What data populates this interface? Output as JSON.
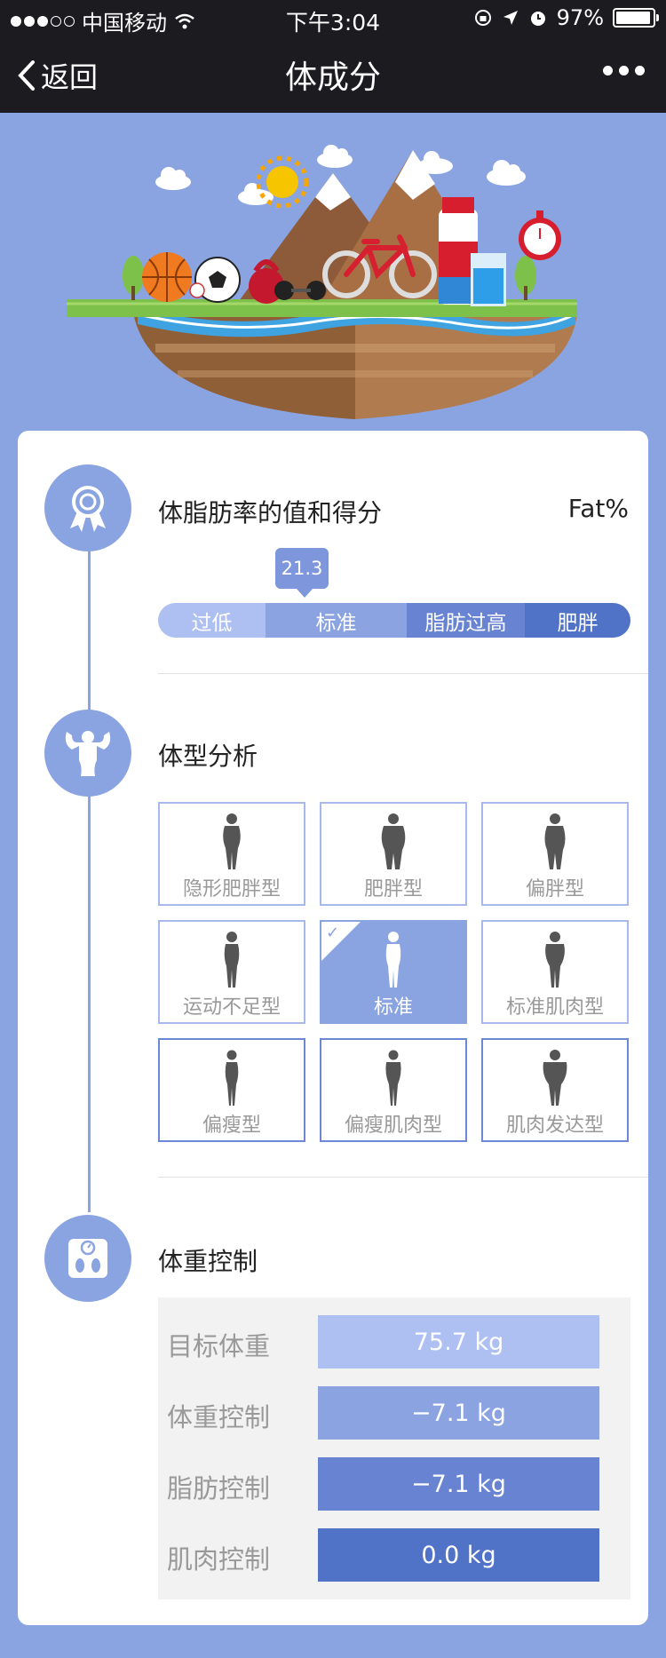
{
  "status_bar": {
    "carrier": "中国移动",
    "time": "下午3:04",
    "battery": "97%",
    "battery_level": 0.97
  },
  "nav": {
    "back_label": "返回",
    "title": "体成分"
  },
  "fat_section": {
    "title": "体脂肪率的值和得分",
    "unit": "Fat%",
    "value": "21.3",
    "levels": [
      "过低",
      "标准",
      "脂肪过高",
      "肥胖"
    ],
    "level_colors": [
      "#aec0f2",
      "#8ba3e1",
      "#6783d2",
      "#5073c8"
    ]
  },
  "body_type_section": {
    "title": "体型分析",
    "types": [
      "隐形肥胖型",
      "肥胖型",
      "偏胖型",
      "运动不足型",
      "标准",
      "标准肌肉型",
      "偏瘦型",
      "偏瘦肌肉型",
      "肌肉发达型"
    ],
    "selected": "标准"
  },
  "weight_section": {
    "title": "体重控制",
    "rows": [
      {
        "label": "目标体重",
        "value": "75.7 kg",
        "color": "#aec0f2"
      },
      {
        "label": "体重控制",
        "value": "−7.1 kg",
        "color": "#8ba3e1"
      },
      {
        "label": "脂肪控制",
        "value": "−7.1 kg",
        "color": "#6783d2"
      },
      {
        "label": "肌肉控制",
        "value": "0.0 kg",
        "color": "#5073c8"
      }
    ]
  },
  "colors": {
    "background": "#8aa3e1",
    "accent": "#8aa3e1",
    "top_bar": "#1c1b20"
  }
}
